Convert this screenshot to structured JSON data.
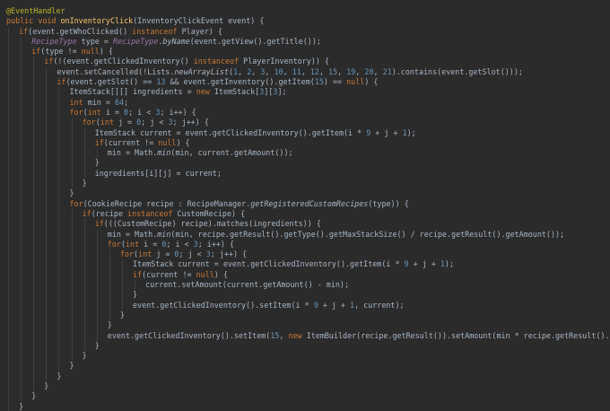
{
  "editor": {
    "lines": [
      {
        "indent": 0,
        "tokens": [
          {
            "c": "annotation",
            "t": "@EventHandler"
          }
        ]
      },
      {
        "indent": 0,
        "tokens": [
          {
            "c": "keyword",
            "t": "public void "
          },
          {
            "c": "method-decl",
            "t": "onInventoryClick"
          },
          {
            "c": "plain",
            "t": "(InventoryClickEvent event) {"
          }
        ]
      },
      {
        "indent": 1,
        "tokens": [
          {
            "c": "keyword",
            "t": "if"
          },
          {
            "c": "plain",
            "t": "(event.getWhoClicked() "
          },
          {
            "c": "keyword",
            "t": "instanceof "
          },
          {
            "c": "plain",
            "t": "Player) {"
          }
        ]
      },
      {
        "indent": 2,
        "tokens": [
          {
            "c": "italic-type",
            "t": "RecipeType"
          },
          {
            "c": "plain",
            "t": " type = "
          },
          {
            "c": "italic-type",
            "t": "RecipeType"
          },
          {
            "c": "plain",
            "t": "."
          },
          {
            "c": "static-call",
            "t": "byName"
          },
          {
            "c": "plain",
            "t": "(event.getView().getTitle());"
          }
        ]
      },
      {
        "indent": 2,
        "tokens": [
          {
            "c": "keyword",
            "t": "if"
          },
          {
            "c": "plain",
            "t": "(type != "
          },
          {
            "c": "keyword",
            "t": "null"
          },
          {
            "c": "plain",
            "t": ") {"
          }
        ]
      },
      {
        "indent": 3,
        "tokens": [
          {
            "c": "keyword",
            "t": "if"
          },
          {
            "c": "plain",
            "t": "(!(event.getClickedInventory() "
          },
          {
            "c": "keyword",
            "t": "instanceof "
          },
          {
            "c": "plain",
            "t": "PlayerInventory)) {"
          }
        ]
      },
      {
        "indent": 4,
        "tokens": [
          {
            "c": "plain",
            "t": "event.setCancelled(!Lists."
          },
          {
            "c": "static-call",
            "t": "newArrayList"
          },
          {
            "c": "plain",
            "t": "("
          },
          {
            "c": "number",
            "t": "1"
          },
          {
            "c": "plain",
            "t": ", "
          },
          {
            "c": "number",
            "t": "2"
          },
          {
            "c": "plain",
            "t": ", "
          },
          {
            "c": "number",
            "t": "3"
          },
          {
            "c": "plain",
            "t": ", "
          },
          {
            "c": "number",
            "t": "10"
          },
          {
            "c": "plain",
            "t": ", "
          },
          {
            "c": "number",
            "t": "11"
          },
          {
            "c": "plain",
            "t": ", "
          },
          {
            "c": "number",
            "t": "12"
          },
          {
            "c": "plain",
            "t": ", "
          },
          {
            "c": "number",
            "t": "15"
          },
          {
            "c": "plain",
            "t": ", "
          },
          {
            "c": "number",
            "t": "19"
          },
          {
            "c": "plain",
            "t": ", "
          },
          {
            "c": "number",
            "t": "20"
          },
          {
            "c": "plain",
            "t": ", "
          },
          {
            "c": "number",
            "t": "21"
          },
          {
            "c": "plain",
            "t": ").contains(event.getSlot()));"
          }
        ]
      },
      {
        "indent": 4,
        "tokens": [
          {
            "c": "keyword",
            "t": "if"
          },
          {
            "c": "plain",
            "t": "(event.getSlot() == "
          },
          {
            "c": "number",
            "t": "13"
          },
          {
            "c": "plain",
            "t": " && event.getInventory().getItem("
          },
          {
            "c": "number",
            "t": "15"
          },
          {
            "c": "plain",
            "t": ") == "
          },
          {
            "c": "keyword",
            "t": "null"
          },
          {
            "c": "plain",
            "t": ") {"
          }
        ]
      },
      {
        "indent": 5,
        "tokens": [
          {
            "c": "plain",
            "t": "ItemStack[][] ingredients = "
          },
          {
            "c": "keyword",
            "t": "new "
          },
          {
            "c": "plain",
            "t": "ItemStack["
          },
          {
            "c": "number",
            "t": "3"
          },
          {
            "c": "plain",
            "t": "]["
          },
          {
            "c": "number",
            "t": "3"
          },
          {
            "c": "plain",
            "t": "];"
          }
        ]
      },
      {
        "indent": 5,
        "tokens": [
          {
            "c": "keyword",
            "t": "int "
          },
          {
            "c": "plain",
            "t": "min = "
          },
          {
            "c": "number",
            "t": "64"
          },
          {
            "c": "plain",
            "t": ";"
          }
        ]
      },
      {
        "indent": 5,
        "tokens": [
          {
            "c": "keyword",
            "t": "for"
          },
          {
            "c": "plain",
            "t": "("
          },
          {
            "c": "keyword",
            "t": "int "
          },
          {
            "c": "plain",
            "t": "i = "
          },
          {
            "c": "number",
            "t": "0"
          },
          {
            "c": "plain",
            "t": "; i < "
          },
          {
            "c": "number",
            "t": "3"
          },
          {
            "c": "plain",
            "t": "; i++) {"
          }
        ]
      },
      {
        "indent": 6,
        "tokens": [
          {
            "c": "keyword",
            "t": "for"
          },
          {
            "c": "plain",
            "t": "("
          },
          {
            "c": "keyword",
            "t": "int "
          },
          {
            "c": "plain",
            "t": "j = "
          },
          {
            "c": "number",
            "t": "0"
          },
          {
            "c": "plain",
            "t": "; j < "
          },
          {
            "c": "number",
            "t": "3"
          },
          {
            "c": "plain",
            "t": "; j++) {"
          }
        ]
      },
      {
        "indent": 7,
        "tokens": [
          {
            "c": "plain",
            "t": "ItemStack current = event.getClickedInventory().getItem(i * "
          },
          {
            "c": "number",
            "t": "9"
          },
          {
            "c": "plain",
            "t": " + j + "
          },
          {
            "c": "number",
            "t": "1"
          },
          {
            "c": "plain",
            "t": ");"
          }
        ]
      },
      {
        "indent": 7,
        "tokens": [
          {
            "c": "keyword",
            "t": "if"
          },
          {
            "c": "plain",
            "t": "(current != "
          },
          {
            "c": "keyword",
            "t": "null"
          },
          {
            "c": "plain",
            "t": ") {"
          }
        ]
      },
      {
        "indent": 8,
        "tokens": [
          {
            "c": "plain",
            "t": "min = Math."
          },
          {
            "c": "static-call",
            "t": "min"
          },
          {
            "c": "plain",
            "t": "(min, current.getAmount());"
          }
        ]
      },
      {
        "indent": 7,
        "tokens": [
          {
            "c": "plain",
            "t": "}"
          }
        ]
      },
      {
        "indent": 7,
        "tokens": [
          {
            "c": "plain",
            "t": "ingredients[i][j] = current;"
          }
        ]
      },
      {
        "indent": 6,
        "tokens": [
          {
            "c": "plain",
            "t": "}"
          }
        ]
      },
      {
        "indent": 5,
        "tokens": [
          {
            "c": "plain",
            "t": "}"
          }
        ]
      },
      {
        "indent": 5,
        "tokens": [
          {
            "c": "keyword",
            "t": "for"
          },
          {
            "c": "plain",
            "t": "(CookieRecipe recipe : RecipeManager."
          },
          {
            "c": "static-call",
            "t": "getRegisteredCustomRecipes"
          },
          {
            "c": "plain",
            "t": "(type)) {"
          }
        ]
      },
      {
        "indent": 6,
        "tokens": [
          {
            "c": "keyword",
            "t": "if"
          },
          {
            "c": "plain",
            "t": "(recipe "
          },
          {
            "c": "keyword",
            "t": "instanceof "
          },
          {
            "c": "plain",
            "t": "CustomRecipe) {"
          }
        ]
      },
      {
        "indent": 7,
        "tokens": [
          {
            "c": "keyword",
            "t": "if"
          },
          {
            "c": "plain",
            "t": "((("
          },
          {
            "c": "plain",
            "t": "CustomRecipe"
          },
          {
            "c": "plain",
            "t": ") recipe).matches(ingredients)) {"
          }
        ]
      },
      {
        "indent": 8,
        "tokens": [
          {
            "c": "plain",
            "t": "min = Math."
          },
          {
            "c": "static-call",
            "t": "min"
          },
          {
            "c": "plain",
            "t": "(min, recipe.getResult().getType().getMaxStackSize() / recipe.getResult().getAmount());"
          }
        ]
      },
      {
        "indent": 8,
        "tokens": [
          {
            "c": "keyword",
            "t": "for"
          },
          {
            "c": "plain",
            "t": "("
          },
          {
            "c": "keyword",
            "t": "int "
          },
          {
            "c": "plain",
            "t": "i = "
          },
          {
            "c": "number",
            "t": "0"
          },
          {
            "c": "plain",
            "t": "; i < "
          },
          {
            "c": "number",
            "t": "3"
          },
          {
            "c": "plain",
            "t": "; i++) {"
          }
        ]
      },
      {
        "indent": 9,
        "tokens": [
          {
            "c": "keyword",
            "t": "for"
          },
          {
            "c": "plain",
            "t": "("
          },
          {
            "c": "keyword",
            "t": "int "
          },
          {
            "c": "plain",
            "t": "j = "
          },
          {
            "c": "number",
            "t": "0"
          },
          {
            "c": "plain",
            "t": "; j < "
          },
          {
            "c": "number",
            "t": "3"
          },
          {
            "c": "plain",
            "t": "; j++) {"
          }
        ]
      },
      {
        "indent": 10,
        "tokens": [
          {
            "c": "plain",
            "t": "ItemStack current = event.getClickedInventory().getItem(i * "
          },
          {
            "c": "number",
            "t": "9"
          },
          {
            "c": "plain",
            "t": " + j + "
          },
          {
            "c": "number",
            "t": "1"
          },
          {
            "c": "plain",
            "t": ");"
          }
        ]
      },
      {
        "indent": 10,
        "tokens": [
          {
            "c": "keyword",
            "t": "if"
          },
          {
            "c": "plain",
            "t": "(current != "
          },
          {
            "c": "keyword",
            "t": "null"
          },
          {
            "c": "plain",
            "t": ") {"
          }
        ]
      },
      {
        "indent": 11,
        "tokens": [
          {
            "c": "plain",
            "t": "current.setAmount(current.getAmount() - min);"
          }
        ]
      },
      {
        "indent": 10,
        "tokens": [
          {
            "c": "plain",
            "t": "}"
          }
        ]
      },
      {
        "indent": 10,
        "tokens": [
          {
            "c": "plain",
            "t": "event.getClickedInventory().setItem(i * "
          },
          {
            "c": "number",
            "t": "9"
          },
          {
            "c": "plain",
            "t": " + j + "
          },
          {
            "c": "number",
            "t": "1"
          },
          {
            "c": "plain",
            "t": ", current);"
          }
        ]
      },
      {
        "indent": 9,
        "tokens": [
          {
            "c": "plain",
            "t": "}"
          }
        ]
      },
      {
        "indent": 8,
        "tokens": [
          {
            "c": "plain",
            "t": "}"
          }
        ]
      },
      {
        "indent": 8,
        "tokens": [
          {
            "c": "plain",
            "t": "event.getClickedInventory().setItem("
          },
          {
            "c": "number",
            "t": "15"
          },
          {
            "c": "plain",
            "t": ", "
          },
          {
            "c": "keyword",
            "t": "new "
          },
          {
            "c": "plain",
            "t": "ItemBuilder(recipe.getResult()).setAmount(min * recipe.getResult().getAmount"
          }
        ]
      },
      {
        "indent": 7,
        "tokens": [
          {
            "c": "plain",
            "t": "}"
          }
        ]
      },
      {
        "indent": 6,
        "tokens": [
          {
            "c": "plain",
            "t": "}"
          }
        ]
      },
      {
        "indent": 5,
        "tokens": [
          {
            "c": "plain",
            "t": "}"
          }
        ]
      },
      {
        "indent": 4,
        "tokens": [
          {
            "c": "plain",
            "t": "}"
          }
        ]
      },
      {
        "indent": 3,
        "tokens": [
          {
            "c": "plain",
            "t": "}"
          }
        ]
      },
      {
        "indent": 2,
        "tokens": [
          {
            "c": "plain",
            "t": "}"
          }
        ]
      },
      {
        "indent": 1,
        "tokens": [
          {
            "c": "plain",
            "t": "}"
          }
        ]
      },
      {
        "indent": 0,
        "tokens": [
          {
            "c": "plain",
            "t": "}"
          }
        ]
      }
    ],
    "colors": {
      "background": "#2b2b2b",
      "keyword": "#cc7832",
      "annotation": "#bbb529",
      "method_declaration": "#ffc66d",
      "number": "#6897bb",
      "default_text": "#a9b7c6",
      "italic_type": "#9876aa"
    }
  }
}
